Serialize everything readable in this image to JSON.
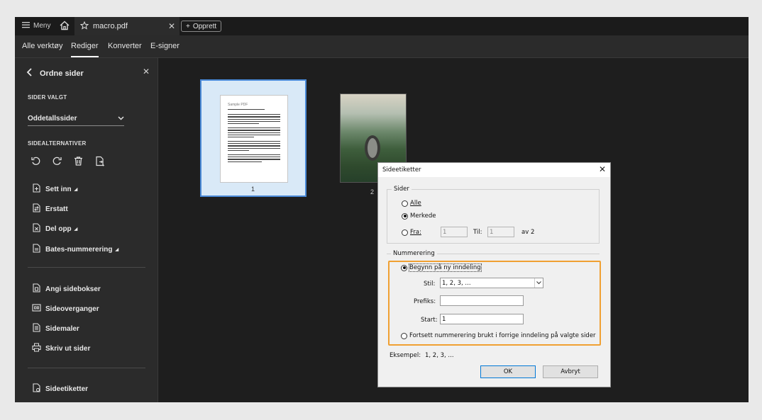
{
  "titlebar": {
    "menu_label": "Meny",
    "tab_title": "macro.pdf",
    "create_label": "Opprett"
  },
  "toolbar": {
    "tabs": [
      "Alle verktøy",
      "Rediger",
      "Konverter",
      "E-signer"
    ],
    "active_tab": "Rediger"
  },
  "sidebar": {
    "title": "Ordne sider",
    "pages_selected_label": "SIDER VALGT",
    "pages_selected_value": "Oddetallssider",
    "page_options_label": "SIDEALTERNATIVER",
    "items": [
      {
        "label": "Sett inn"
      },
      {
        "label": "Erstatt"
      },
      {
        "label": "Del opp"
      },
      {
        "label": "Bates-nummerering"
      },
      {
        "label": "Angi sidebokser"
      },
      {
        "label": "Sideoverganger"
      },
      {
        "label": "Sidemaler"
      },
      {
        "label": "Skriv ut sider"
      },
      {
        "label": "Sideetiketter"
      }
    ]
  },
  "canvas": {
    "page1_title": "Sample PDF",
    "page1_number": "1",
    "page2_number": "2"
  },
  "dialog": {
    "title": "Sideetiketter",
    "pages_group": "Sider",
    "opt_all": "Alle",
    "opt_selected": "Merkede",
    "opt_from": "Fra:",
    "from_value": "1",
    "to_label": "Til:",
    "to_value": "1",
    "of_label": "av 2",
    "numbering_group": "Nummerering",
    "opt_begin_new": "Begynn på ny inndeling",
    "style_label": "Stil:",
    "style_value": "1, 2, 3, ...",
    "prefix_label": "Prefiks:",
    "prefix_value": "",
    "start_label": "Start:",
    "start_value": "1",
    "opt_continue": "Fortsett nummerering brukt i forrige inndeling på valgte sider",
    "example_label": "Eksempel:",
    "example_value": "1, 2, 3, ...",
    "ok_label": "OK",
    "cancel_label": "Avbryt"
  },
  "colors": {
    "highlight": "#f0a032",
    "selection": "#4a8ad8"
  }
}
